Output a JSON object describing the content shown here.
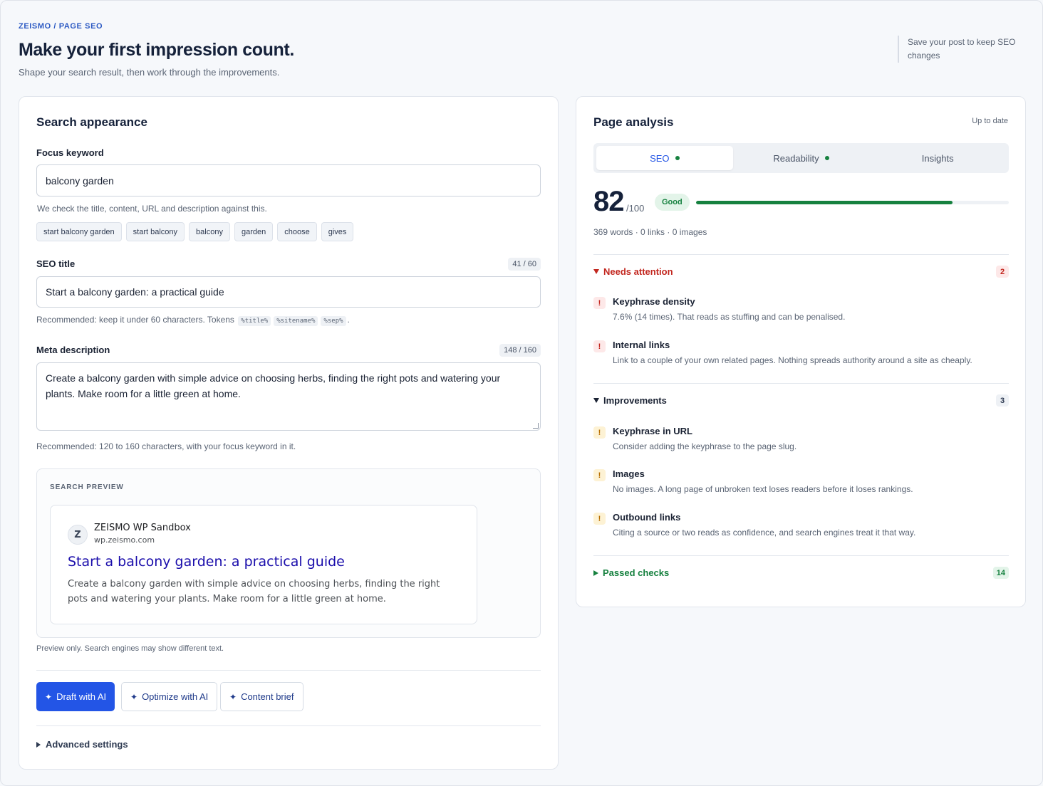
{
  "header": {
    "breadcrumb": "ZEISMO / PAGE SEO",
    "title": "Make your first impression count.",
    "subtitle": "Shape your search result, then work through the improvements.",
    "save_note": "Save your post to keep SEO changes"
  },
  "search_appearance": {
    "title": "Search appearance",
    "focus_keyword": {
      "label": "Focus keyword",
      "value": "balcony garden",
      "hint": "We check the title, content, URL and description against this.",
      "suggestions": [
        "start balcony garden",
        "start balcony",
        "balcony",
        "garden",
        "choose",
        "gives"
      ]
    },
    "seo_title": {
      "label": "SEO title",
      "count": "41 / 60",
      "value": "Start a balcony garden: a practical guide",
      "hint_prefix": "Recommended: keep it under 60 characters. Tokens",
      "tokens": [
        "%title%",
        "%sitename%",
        "%sep%"
      ],
      "hint_suffix": "."
    },
    "meta_description": {
      "label": "Meta description",
      "count": "148 / 160",
      "value": "Create a balcony garden with simple advice on choosing herbs, finding the right pots and watering your plants. Make room for a little green at home.",
      "hint": "Recommended: 120 to 160 characters, with your focus keyword in it."
    },
    "preview": {
      "label": "SEARCH PREVIEW",
      "favicon_letter": "Z",
      "site_name": "ZEISMO WP Sandbox",
      "url": "wp.zeismo.com",
      "title": "Start a balcony garden: a practical guide",
      "description": "Create a balcony garden with simple advice on choosing herbs, finding the right pots and watering your plants. Make room for a little green at home.",
      "note": "Preview only. Search engines may show different text."
    },
    "actions": {
      "draft": "Draft with AI",
      "optimize": "Optimize with AI",
      "brief": "Content brief",
      "sparkle_icon": "✦"
    },
    "advanced": "Advanced settings"
  },
  "analysis": {
    "title": "Page analysis",
    "status": "Up to date",
    "tabs": [
      {
        "label": "SEO",
        "dot": true
      },
      {
        "label": "Readability",
        "dot": true
      },
      {
        "label": "Insights",
        "dot": false
      }
    ],
    "score": "82",
    "score_max": "/100",
    "score_fraction": 0.82,
    "rating": "Good",
    "stats": "369 words · 0 links · 0 images",
    "sections": {
      "needs_attention": {
        "label": "Needs attention",
        "count": "2",
        "items": [
          {
            "title": "Keyphrase density",
            "desc": "7.6% (14 times). That reads as stuffing and can be penalised.",
            "icon": "!"
          },
          {
            "title": "Internal links",
            "desc": "Link to a couple of your own related pages. Nothing spreads authority around a site as cheaply.",
            "icon": "!"
          }
        ]
      },
      "improvements": {
        "label": "Improvements",
        "count": "3",
        "items": [
          {
            "title": "Keyphrase in URL",
            "desc": "Consider adding the keyphrase to the page slug.",
            "icon": "!"
          },
          {
            "title": "Images",
            "desc": "No images. A long page of unbroken text loses readers before it loses rankings.",
            "icon": "!"
          },
          {
            "title": "Outbound links",
            "desc": "Citing a source or two reads as confidence, and search engines treat it that way.",
            "icon": "!"
          }
        ]
      },
      "passed": {
        "label": "Passed checks",
        "count": "14"
      }
    }
  },
  "colors": {
    "accent": "#2355e6",
    "good": "#16813f",
    "danger": "#c2271f",
    "warning": "#b76e00"
  }
}
